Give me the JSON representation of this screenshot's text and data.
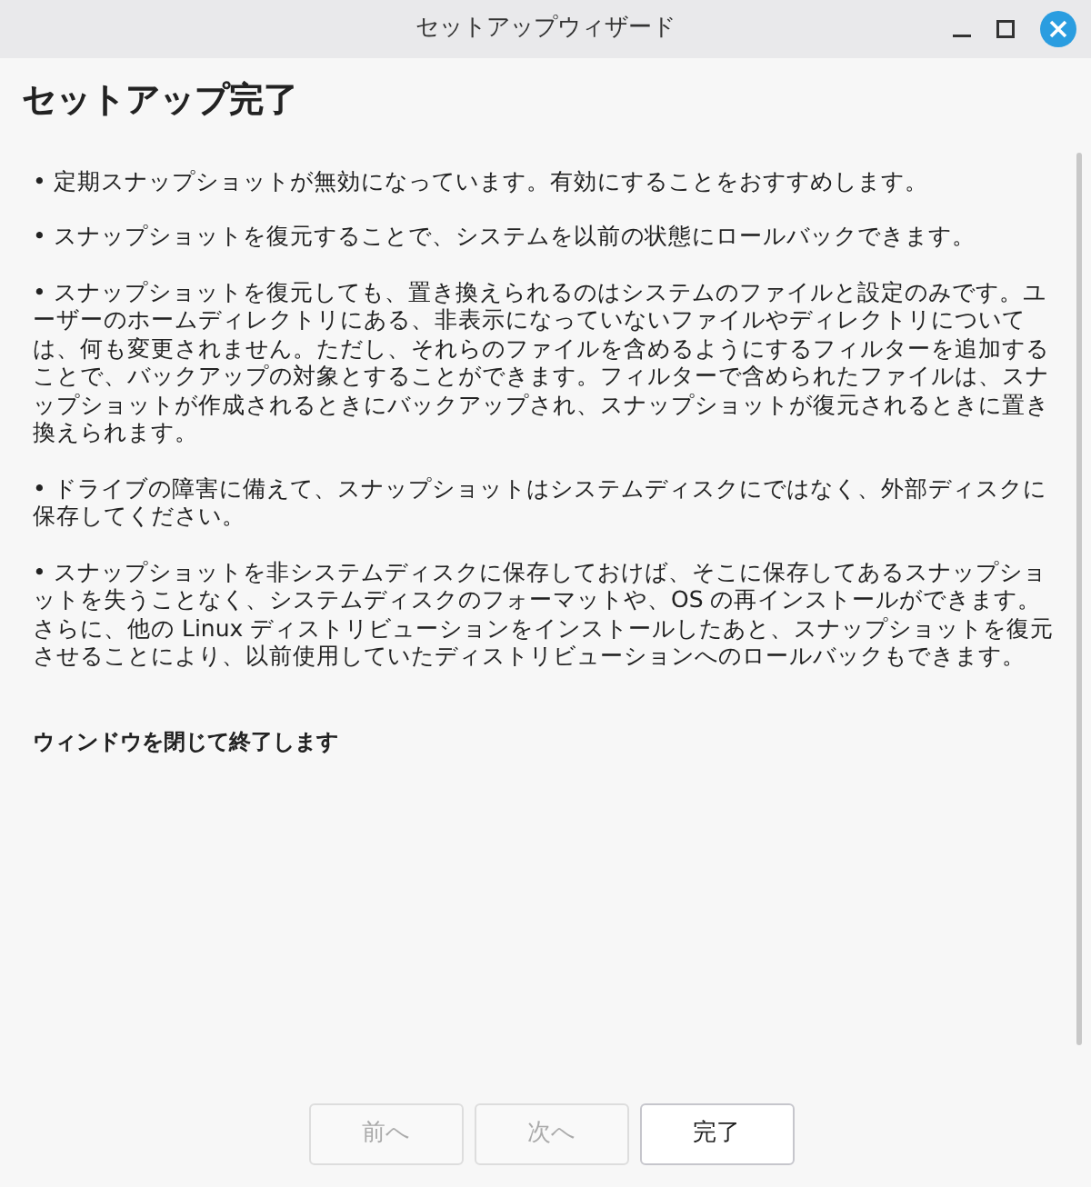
{
  "window": {
    "title": "セットアップウィザード"
  },
  "heading": "セットアップ完了",
  "paragraphs": [
    "• 定期スナップショットが無効になっています。有効にすることをおすすめします。",
    "• スナップショットを復元することで、システムを以前の状態にロールバックできます。",
    "• スナップショットを復元しても、置き換えられるのはシステムのファイルと設定のみです。ユーザーのホームディレクトリにある、非表示になっていないファイルやディレクトリについては、何も変更されません。ただし、それらのファイルを含めるようにするフィルターを追加することで、バックアップの対象とすることができます。フィルターで含められたファイルは、スナップショットが作成されるときにバックアップされ、スナップショットが復元されるときに置き換えられます。",
    "• ドライブの障害に備えて、スナップショットはシステムディスクにではなく、外部ディスクに保存してください。",
    "• スナップショットを非システムディスクに保存しておけば、そこに保存してあるスナップショットを失うことなく、システムディスクのフォーマットや、OS の再インストールができます。さらに、他の  Linux ディストリビューションをインストールしたあと、スナップショットを復元させることにより、以前使用していたディストリビューションへのロールバックもできます。"
  ],
  "closing_note": "ウィンドウを閉じて終了します",
  "buttons": [
    {
      "label": "前へ",
      "disabled": true
    },
    {
      "label": "次へ",
      "disabled": true
    },
    {
      "label": "完了",
      "disabled": false
    }
  ]
}
